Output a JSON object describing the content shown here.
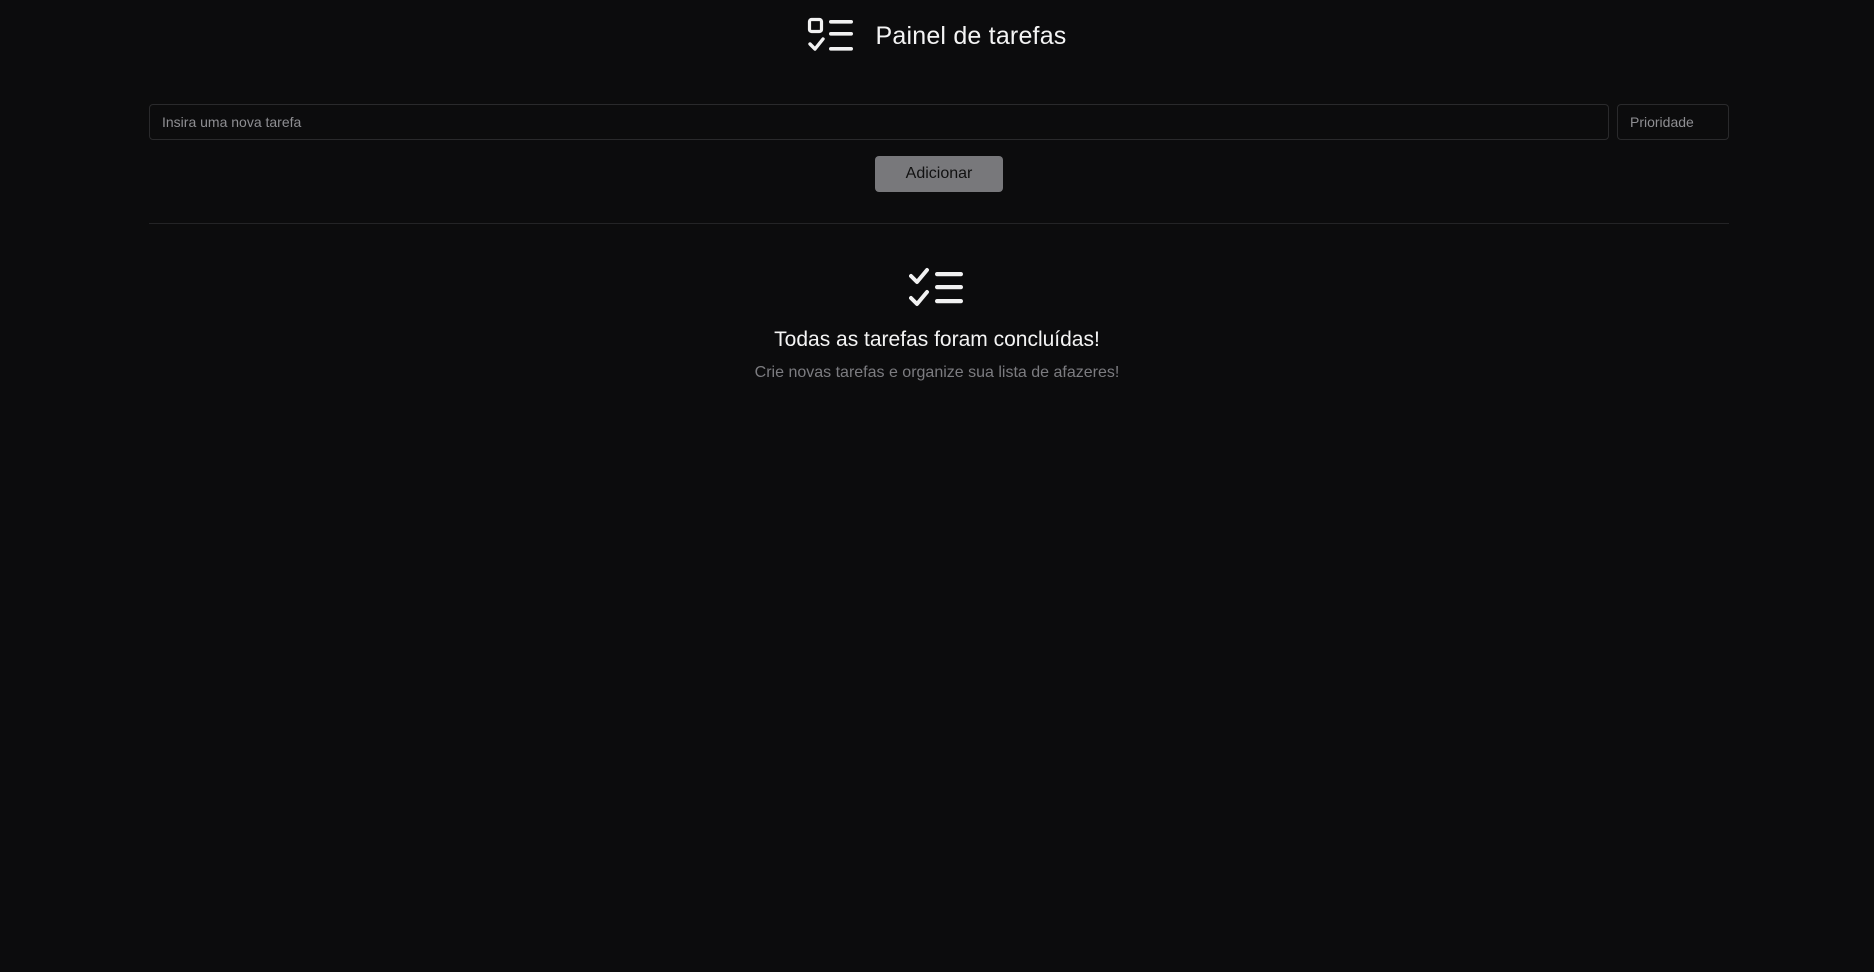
{
  "header": {
    "title": "Painel de tarefas",
    "icon": "task-list-icon"
  },
  "form": {
    "task_placeholder": "Insira uma nova tarefa",
    "priority_placeholder": "Prioridade",
    "add_label": "Adicionar"
  },
  "empty_state": {
    "icon": "checklist-icon",
    "title": "Todas as tarefas foram concluídas!",
    "subtitle": "Crie novas tarefas e organize sua lista de afazeres!"
  },
  "colors": {
    "background": "#0c0c0d",
    "button": "#78787b",
    "border": "#2a2a2c",
    "muted_text": "#7c7c80"
  }
}
